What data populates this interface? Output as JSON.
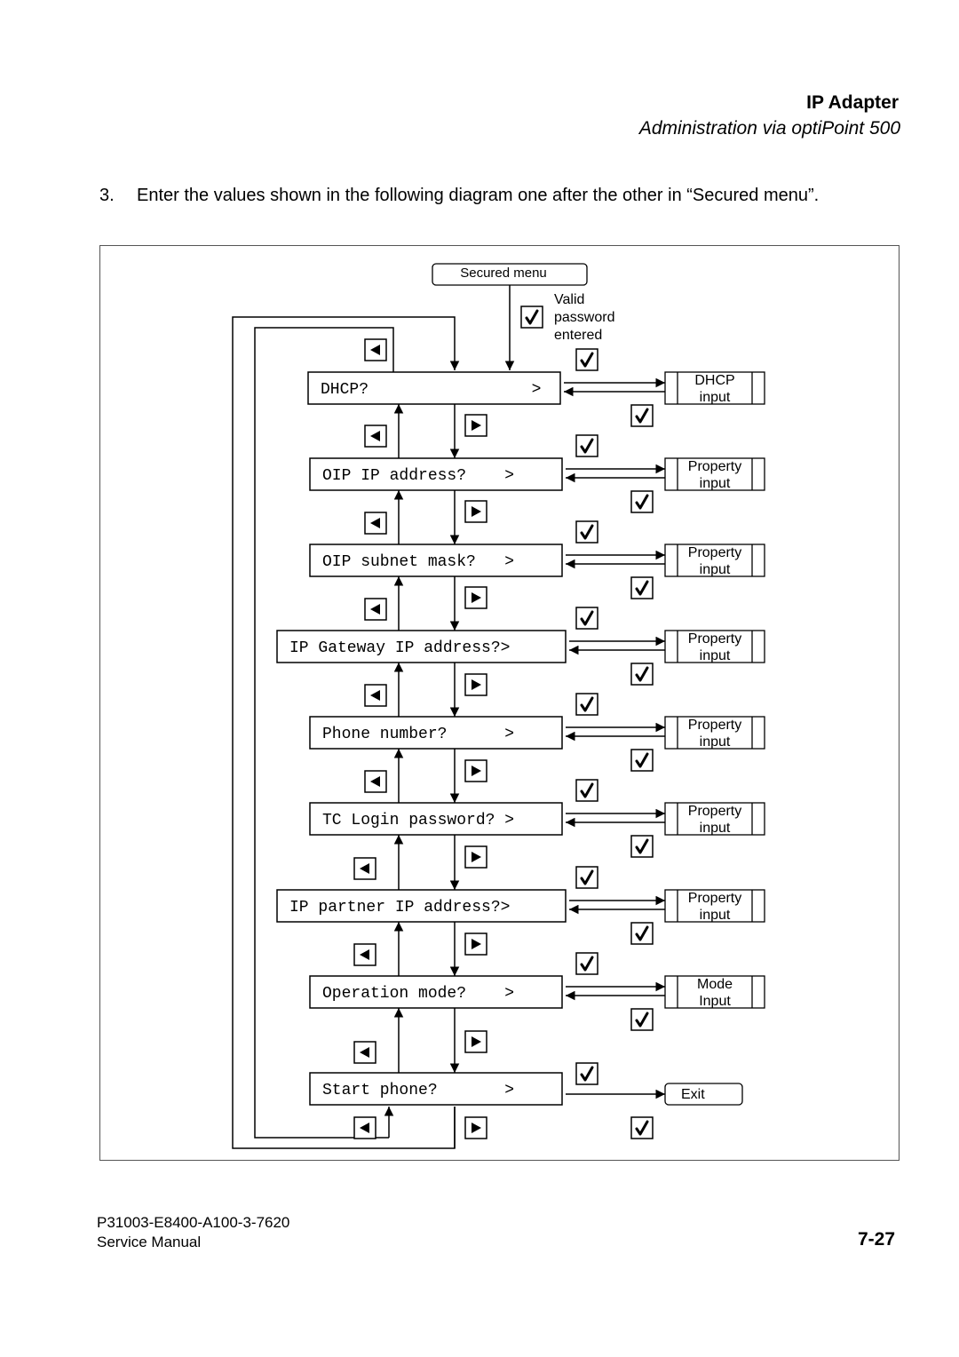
{
  "header": {
    "title": "IP Adapter",
    "subtitle": "Administration via optiPoint 500"
  },
  "instruction": {
    "number": "3.",
    "text": "Enter the values shown in the following diagram one after the other in “Secured menu”."
  },
  "diagram": {
    "start_label": "Secured menu",
    "start_condition": [
      "Valid",
      "password",
      "entered"
    ],
    "menu_items": [
      {
        "label": "DHCP?                 >",
        "target": [
          "DHCP",
          "input"
        ]
      },
      {
        "label": "OIP IP address?    >",
        "target": [
          "Property",
          "input"
        ]
      },
      {
        "label": "OIP subnet mask?   >",
        "target": [
          "Property",
          "input"
        ]
      },
      {
        "label": "IP Gateway IP address?>",
        "target": [
          "Property",
          "input"
        ]
      },
      {
        "label": "Phone number?      >",
        "target": [
          "Property",
          "input"
        ]
      },
      {
        "label": "TC Login password? >",
        "target": [
          "Property",
          "input"
        ]
      },
      {
        "label": "IP partner IP address?>",
        "target": [
          "Property",
          "input"
        ]
      },
      {
        "label": "Operation mode?    >",
        "target": [
          "Mode",
          "Input"
        ]
      },
      {
        "label": "Start phone?       >",
        "target": [
          "Exit"
        ]
      }
    ],
    "icons": {
      "confirm": "checkmark-key",
      "back": "left-arrow-key",
      "forward": "right-arrow-key"
    }
  },
  "footer": {
    "doc_code": "P31003-E8400-A100-3-7620",
    "manual": "Service Manual",
    "page": "7-27"
  }
}
